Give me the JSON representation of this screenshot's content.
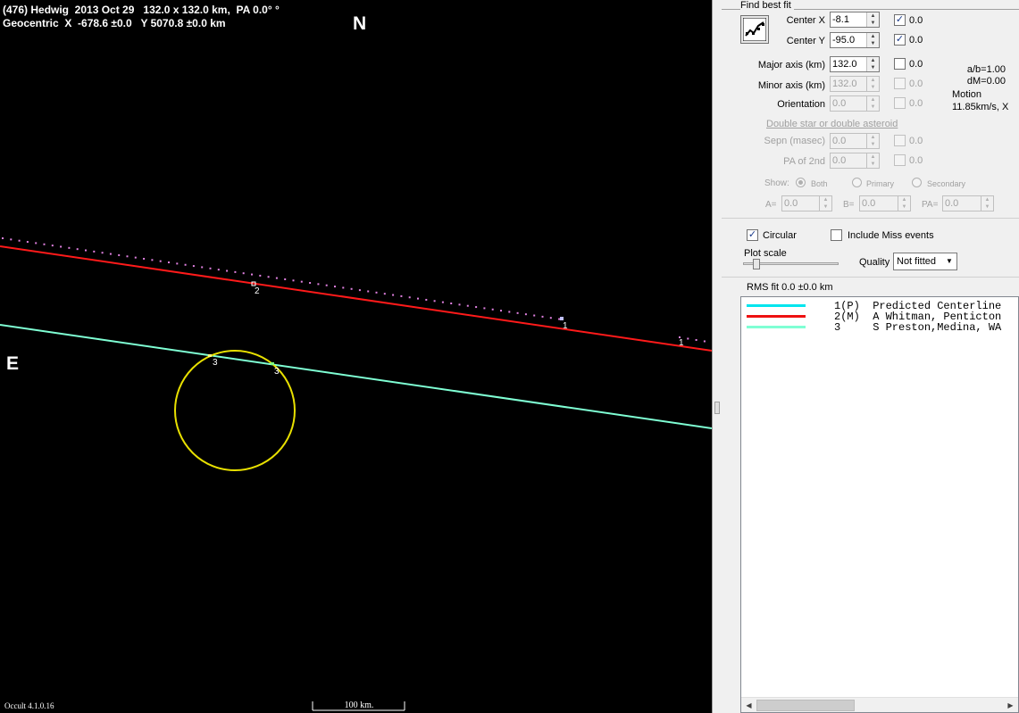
{
  "plot": {
    "header_line1": "(476) Hedwig  2013 Oct 29   132.0 x 132.0 km,  PA 0.0° °",
    "header_line2": "Geocentric  X  -678.6 ±0.0   Y 5070.8 ±0.0 km",
    "north_label": "N",
    "east_label": "E",
    "version": "Occult 4.1.0.16",
    "scale_label": "100 km.",
    "chord_labels": {
      "red_mid": "2",
      "dots_end": "1",
      "dots_right": "1",
      "cyan_left": "3",
      "cyan_right": "3"
    },
    "colors": {
      "predicted_dots": "#e080e0",
      "red_chord": "#ff1a1a",
      "cyan_chord": "#7fffd4",
      "ellipse": "#e8e000",
      "background": "#000000"
    }
  },
  "panel": {
    "find_best_fit": "Find best fit",
    "center_x_label": "Center X",
    "center_x_value": "-8.1",
    "center_x_fit": "0.0",
    "center_y_label": "Center Y",
    "center_y_value": "-95.0",
    "center_y_fit": "0.0",
    "major_axis_label": "Major axis (km)",
    "major_axis_value": "132.0",
    "major_axis_fit": "0.0",
    "minor_axis_label": "Minor axis (km)",
    "minor_axis_value": "132.0",
    "minor_axis_fit": "0.0",
    "orientation_label": "Orientation",
    "orientation_value": "0.0",
    "orientation_fit": "0.0",
    "ab_ratio": "a/b=1.00",
    "dm": "dM=0.00",
    "motion_label": "Motion",
    "motion_value": "11.85km/s, X",
    "double_star_link": "Double star  or  double asteroid",
    "sepn_label": "Sepn (masec)",
    "sepn_value": "0.0",
    "sepn_fit": "0.0",
    "pa2_label": "PA of 2nd",
    "pa2_value": "0.0",
    "pa2_fit": "0.0",
    "show_label": "Show:",
    "show_both": "Both",
    "show_primary": "Primary",
    "show_secondary": "Secondary",
    "a_label": "A=",
    "a_value": "0.0",
    "b_label": "B=",
    "b_value": "0.0",
    "pa_label": "PA=",
    "pa_value": "0.0",
    "circular_label": "Circular",
    "include_miss_label": "Include Miss events",
    "plot_scale_label": "Plot scale",
    "quality_label": "Quality",
    "quality_value": "Not fitted",
    "rms_fit": "RMS fit 0.0 ±0.0 km",
    "check_mark": "✓"
  },
  "legend": [
    {
      "text": "1(P)  Predicted Centerline",
      "color": "#00e5ee"
    },
    {
      "text": "2(M)  A Whitman, Penticton",
      "color": "#ee1111"
    },
    {
      "text": "3     S Preston,Medina, WA",
      "color": "#7fffd4"
    }
  ]
}
